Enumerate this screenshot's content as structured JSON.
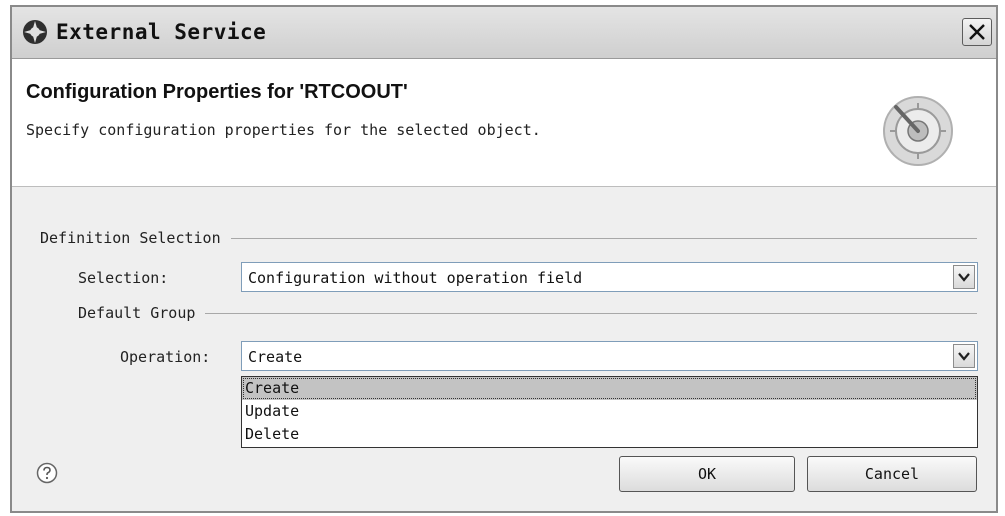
{
  "window": {
    "title": "External Service"
  },
  "header": {
    "title": "Configuration Properties for 'RTCOOUT'",
    "description": "Specify configuration properties for the selected object."
  },
  "definition_selection": {
    "group_label": "Definition Selection",
    "selection_label": "Selection:",
    "selection_value": "Configuration without operation field"
  },
  "default_group": {
    "group_label": "Default Group",
    "operation_label": "Operation:",
    "operation_value": "Create",
    "options": [
      "Create",
      "Update",
      "Delete"
    ],
    "selected_index": 0
  },
  "buttons": {
    "ok": "OK",
    "cancel": "Cancel"
  },
  "icons": {
    "app": "service-gear-icon",
    "close": "close-icon",
    "wizard": "wizard-dial-icon",
    "help": "help-icon",
    "dropdown": "chevron-down-icon"
  }
}
